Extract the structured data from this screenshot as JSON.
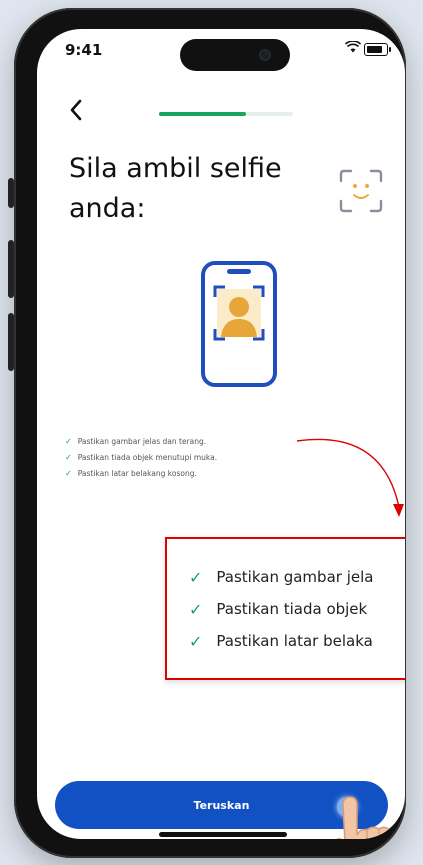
{
  "status_bar": {
    "time": "9:41",
    "wifi_icon": "wifi-icon",
    "battery_icon": "battery-icon"
  },
  "nav": {
    "back_icon": "chevron-left-icon",
    "progress": 0.65,
    "progress_color": "#1aa35a"
  },
  "page": {
    "title": "Sila ambil selfie anda:"
  },
  "tips": [
    "Pastikan gambar jelas dan terang.",
    "Pastikan tiada objek menutupi muka.",
    "Pastikan latar belakang kosong."
  ],
  "zoom_tips": [
    "Pastikan gambar jela",
    "Pastikan tiada objek",
    "Pastikan latar belaka"
  ],
  "colors": {
    "accent": "#1251c4",
    "success": "#1aa35a",
    "highlight": "#e00000",
    "illustration_accent": "#f0a93b"
  },
  "cta": {
    "label": "Teruskan"
  }
}
